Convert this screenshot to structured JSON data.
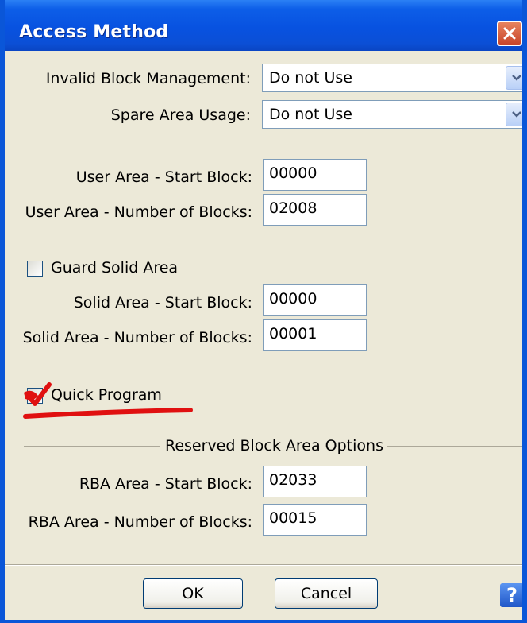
{
  "window": {
    "title": "Access Method"
  },
  "fields": {
    "invalid_block_management": {
      "label": "Invalid Block Management:",
      "value": "Do not Use"
    },
    "spare_area_usage": {
      "label": "Spare Area Usage:",
      "value": "Do not Use"
    },
    "user_area_start": {
      "label": "User Area - Start Block:",
      "value": "00000"
    },
    "user_area_number": {
      "label": "User Area - Number of Blocks:",
      "value": "02008"
    },
    "guard_solid_area": {
      "label": "Guard Solid Area",
      "checked": false
    },
    "solid_area_start": {
      "label": "Solid Area - Start Block:",
      "value": "00000"
    },
    "solid_area_number": {
      "label": "Solid Area - Number of Blocks:",
      "value": "00001"
    },
    "quick_program": {
      "label": "Quick Program",
      "checked": true
    }
  },
  "rba_section": {
    "title": "Reserved Block Area Options",
    "start": {
      "label": "RBA Area - Start Block:",
      "value": "02033"
    },
    "number": {
      "label": "RBA Area - Number of Blocks:",
      "value": "00015"
    }
  },
  "buttons": {
    "ok": "OK",
    "cancel": "Cancel",
    "help": "?"
  },
  "colors": {
    "titlebar": "#0852e0",
    "dialog_bg": "#ece9d8",
    "annotation_red": "#e01010",
    "close_button": "#d1553a"
  }
}
